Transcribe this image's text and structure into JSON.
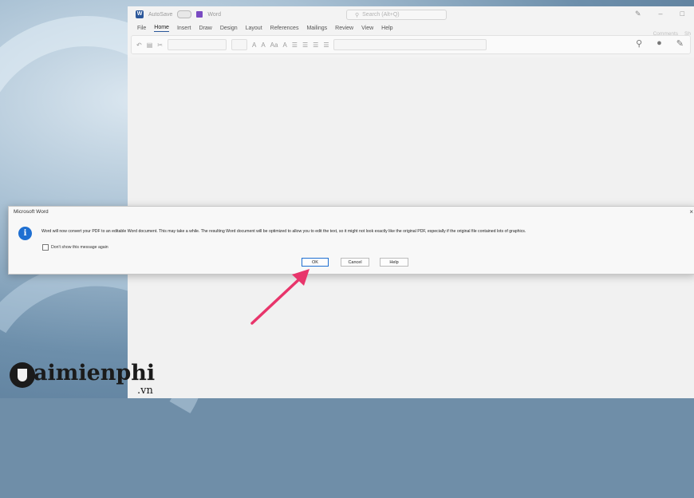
{
  "window": {
    "autosave_label": "AutoSave",
    "autosave_state": "Off",
    "app_name": "Word",
    "search_placeholder": "Search (Alt+Q)"
  },
  "menu": {
    "items": [
      "File",
      "Home",
      "Insert",
      "Draw",
      "Design",
      "Layout",
      "References",
      "Mailings",
      "Review",
      "View",
      "Help"
    ],
    "active": "Home",
    "comments_label": "Comments",
    "share_label": "Sh"
  },
  "dialog": {
    "title": "Microsoft Word",
    "close_label": "×",
    "message": "Word will now convert your PDF to an editable Word document. This may take a while. The resulting Word document will be optimized to allow you to edit the text, so it might not look exactly like the original PDF, especially if the original file contained lots of graphics.",
    "checkbox_label": "Don't show this message again",
    "buttons": {
      "ok": "OK",
      "cancel": "Cancel",
      "help": "Help"
    }
  },
  "watermark": {
    "brand": "aimienphi",
    "suffix": ".vn"
  },
  "colors": {
    "accent": "#1f6fd1",
    "arrow": "#e8356b",
    "word_blue": "#2b579a"
  }
}
